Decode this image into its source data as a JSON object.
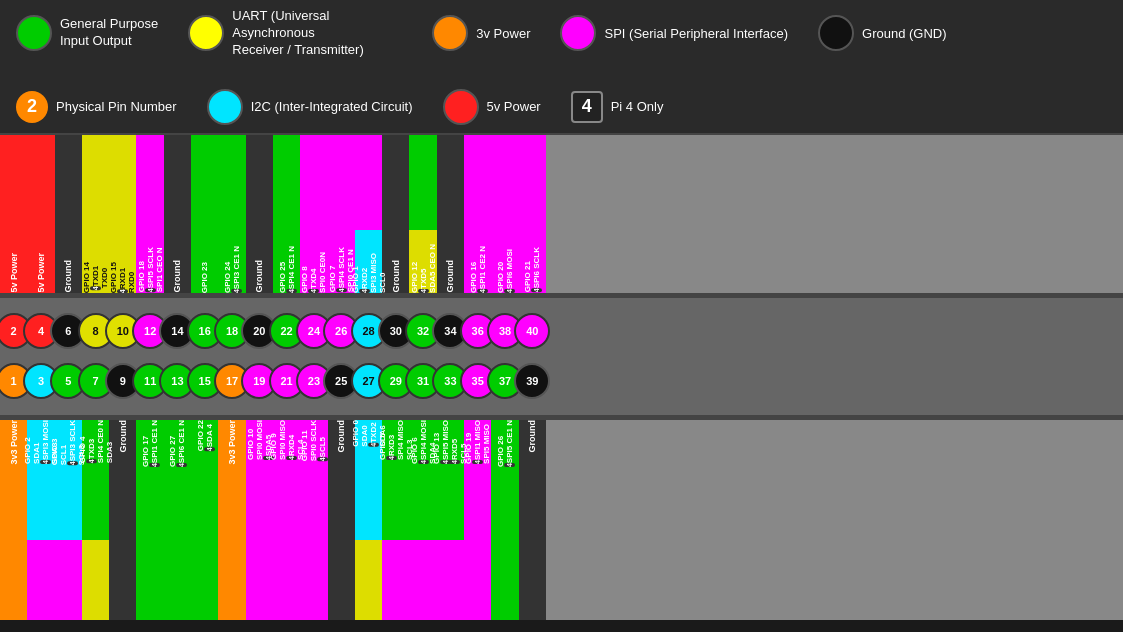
{
  "legend": {
    "items": [
      {
        "id": "gpio",
        "label": "General Purpose\nInput Output",
        "color": "#00cc00",
        "type": "circle"
      },
      {
        "id": "uart",
        "label": "UART (Universal Asynchronous\nReceiver / Transmitter)",
        "color": "#ffff00",
        "type": "circle"
      },
      {
        "id": "3v",
        "label": "3v Power",
        "color": "#ff8800",
        "type": "circle"
      },
      {
        "id": "spi",
        "label": "SPI (Serial Peripheral Interface)",
        "color": "#ff00ff",
        "type": "circle"
      },
      {
        "id": "gnd",
        "label": "Ground (GND)",
        "color": "#111111",
        "type": "circle"
      },
      {
        "id": "physical",
        "label": "Physical Pin Number",
        "color": "#ff8800",
        "type": "num",
        "num": "2"
      },
      {
        "id": "i2c",
        "label": "I2C (Inter-Integrated Circuit)",
        "color": "#00ffff",
        "type": "circle"
      },
      {
        "id": "5v",
        "label": "5v Power",
        "color": "#ff2020",
        "type": "circle"
      },
      {
        "id": "pi4only",
        "label": "Pi 4 Only",
        "color": "#222",
        "type": "num",
        "num": "4"
      }
    ]
  },
  "pins": {
    "top": [
      {
        "num": 2,
        "label": "5v Power",
        "color": "5v",
        "sublabel": ""
      },
      {
        "num": 4,
        "label": "5v Power",
        "color": "5v",
        "sublabel": ""
      },
      {
        "num": 6,
        "label": "Ground",
        "color": "gnd",
        "sublabel": ""
      },
      {
        "num": 8,
        "label": "GPIO 14",
        "color": "uart",
        "sublabel": "TXD1 4 TXD0"
      },
      {
        "num": 10,
        "label": "GPIO 15",
        "color": "uart",
        "sublabel": "RXD1 4 RXD0"
      },
      {
        "num": 12,
        "label": "GPIO 18",
        "color": "pi4",
        "sublabel": "SPI1 CEO N"
      },
      {
        "num": 14,
        "label": "Ground",
        "color": "gnd",
        "sublabel": ""
      },
      {
        "num": 16,
        "label": "GPIO 23",
        "color": "gpio",
        "sublabel": ""
      },
      {
        "num": 18,
        "label": "GPIO 24",
        "color": "gpio",
        "sublabel": ""
      },
      {
        "num": 20,
        "label": "Ground",
        "color": "gnd",
        "sublabel": ""
      },
      {
        "num": 22,
        "label": "GPIO 25",
        "color": "gpio",
        "sublabel": ""
      },
      {
        "num": 24,
        "label": "GPIO 8",
        "color": "spi",
        "sublabel": "SPI0 CEO N 4 SPI4 CE1 N"
      },
      {
        "num": 26,
        "label": "GPIO 7",
        "color": "spi",
        "sublabel": "SPI0 CE1 N 4 SCL4"
      },
      {
        "num": 28,
        "label": "GPIO 1",
        "color": "i2c",
        "sublabel": "RXD2 4 SPI3 MISO SCL0"
      },
      {
        "num": 30,
        "label": "Ground",
        "color": "gnd",
        "sublabel": ""
      },
      {
        "num": 32,
        "label": "GPIO 12",
        "color": "gpio",
        "sublabel": "TXD5 4 SDA5 CEO N"
      },
      {
        "num": 34,
        "label": "Ground",
        "color": "gnd",
        "sublabel": ""
      },
      {
        "num": 36,
        "label": "GPIO 16",
        "color": "spi",
        "sublabel": "SPI1 CE2 N 4"
      },
      {
        "num": 38,
        "label": "GPIO 20",
        "color": "spi",
        "sublabel": "SPI6 MOSI 4"
      },
      {
        "num": 40,
        "label": "GPIO 21",
        "color": "spi",
        "sublabel": "SPI6 SCLK 4"
      }
    ],
    "bottom": [
      {
        "num": 1,
        "label": "3v3 Power",
        "color": "3v3",
        "sublabel": ""
      },
      {
        "num": 3,
        "label": "GPIO 2",
        "color": "i2c",
        "sublabel": "SDA1 4 SPI3 MOSI SDA3"
      },
      {
        "num": 5,
        "label": "GPIO 3",
        "color": "i2c",
        "sublabel": "SCL1 4 SPI3 SCLK SCL3"
      },
      {
        "num": 7,
        "label": "GPIO 4",
        "color": "gpio",
        "sublabel": "TXD3 4 SPI4 CE0 N SDA3"
      },
      {
        "num": 9,
        "label": "Ground",
        "color": "gnd",
        "sublabel": ""
      },
      {
        "num": 11,
        "label": "GPIO 17",
        "color": "gpio",
        "sublabel": "SPI1 CE1 N 4"
      },
      {
        "num": 13,
        "label": "GPIO 27",
        "color": "gpio",
        "sublabel": "SPI6 CE1 N 4"
      },
      {
        "num": 15,
        "label": "GPIO 22",
        "color": "gpio",
        "sublabel": "SDA 4"
      },
      {
        "num": 17,
        "label": "3v3 Power",
        "color": "3v3",
        "sublabel": ""
      },
      {
        "num": 19,
        "label": "GPIO 10",
        "color": "spi",
        "sublabel": "SPI0 MOSI 4 SDA5"
      },
      {
        "num": 21,
        "label": "GPIO 9",
        "color": "spi",
        "sublabel": "SPI0 MISO 4 RXD4 SCL4"
      },
      {
        "num": 23,
        "label": "GPIO 11",
        "color": "spi",
        "sublabel": "SPI0 SCLK 4 SCL5"
      },
      {
        "num": 25,
        "label": "Ground",
        "color": "gnd",
        "sublabel": ""
      },
      {
        "num": 27,
        "label": "GPIO 0",
        "color": "i2c",
        "sublabel": "SDA0 4 TXD2 SDA6"
      },
      {
        "num": 29,
        "label": "GPIO 5",
        "color": "gpio",
        "sublabel": "RXD3 4 SPI4 MISO SCL3"
      },
      {
        "num": 31,
        "label": "GPIO 6",
        "color": "gpio",
        "sublabel": "SPI4 MOSI 4 SDA4"
      },
      {
        "num": 33,
        "label": "GPIO 13",
        "color": "gpio",
        "sublabel": "SPI5 MISO 4 RXD5 SCL5"
      },
      {
        "num": 35,
        "label": "GPIO 19",
        "color": "spi",
        "sublabel": "SPI1 MISO 4 SPI5 MISO"
      },
      {
        "num": 37,
        "label": "GPIO 26",
        "color": "gpio",
        "sublabel": "SPI5 CE1 N 4"
      },
      {
        "num": 39,
        "label": "Ground",
        "color": "gnd",
        "sublabel": ""
      }
    ]
  },
  "colors": {
    "5v": "#ff2020",
    "3v3": "#ff8800",
    "gnd": "#111111",
    "gpio": "#00cc00",
    "spi": "#ff00ff",
    "i2c": "#00e5ff",
    "uart": "#e0e000",
    "pi4": "#2233ff"
  }
}
